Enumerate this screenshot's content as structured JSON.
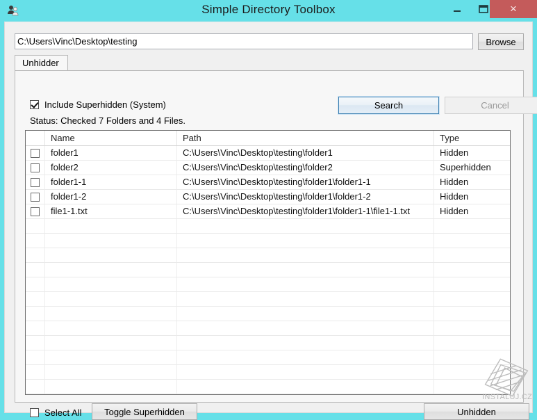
{
  "window": {
    "title": "Simple Directory Toolbox",
    "icon": "users-icon",
    "titlebar_color": "#66e0e8",
    "close_button_color": "#c45b5b",
    "controls": {
      "minimize": "minimize-icon",
      "maximize": "maximize-icon",
      "close": "×"
    }
  },
  "pathbar": {
    "value": "C:\\Users\\Vinc\\Desktop\\testing",
    "placeholder": "",
    "browse_label": "Browse"
  },
  "tabs": [
    {
      "label": "Unhidder",
      "selected": true
    }
  ],
  "options": {
    "include_superhidden_label": "Include Superhidden (System)",
    "include_superhidden_checked": true,
    "status": "Status: Checked 7 Folders and 4 Files."
  },
  "actions": {
    "search_label": "Search",
    "search_enabled": true,
    "cancel_label": "Cancel",
    "cancel_enabled": false
  },
  "grid": {
    "columns": [
      "",
      "Name",
      "Path",
      "Type"
    ],
    "rows": [
      {
        "checked": false,
        "name": "folder1",
        "path": "C:\\Users\\Vinc\\Desktop\\testing\\folder1",
        "type": "Hidden"
      },
      {
        "checked": false,
        "name": "folder2",
        "path": "C:\\Users\\Vinc\\Desktop\\testing\\folder2",
        "type": "Superhidden"
      },
      {
        "checked": false,
        "name": "folder1-1",
        "path": "C:\\Users\\Vinc\\Desktop\\testing\\folder1\\folder1-1",
        "type": "Hidden"
      },
      {
        "checked": false,
        "name": "folder1-2",
        "path": "C:\\Users\\Vinc\\Desktop\\testing\\folder1\\folder1-2",
        "type": "Hidden"
      },
      {
        "checked": false,
        "name": "file1-1.txt",
        "path": "C:\\Users\\Vinc\\Desktop\\testing\\folder1\\folder1-1\\file1-1.txt",
        "type": "Hidden"
      }
    ],
    "empty_row_count": 13
  },
  "footer": {
    "select_all_label": "Select All",
    "select_all_checked": false,
    "toggle_superhidden_label": "Toggle Superhidden",
    "unhidden_label": "Unhidden"
  },
  "watermark": {
    "text": "INSTALUJ.CZ",
    "logo": "diamond-logo-icon"
  }
}
